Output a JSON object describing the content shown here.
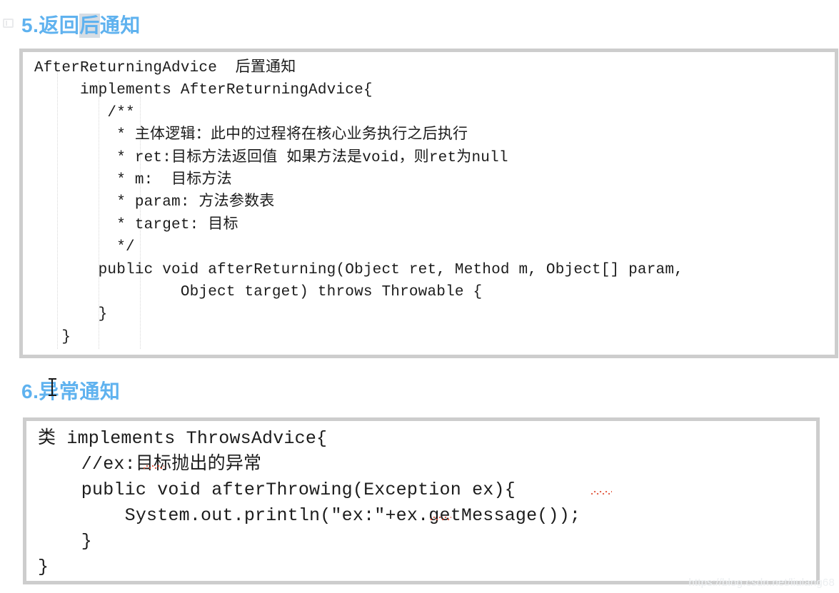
{
  "page": {
    "background_color": "#ffffff",
    "heading_color": "#5fb2ef",
    "selection_color": "#d6dde4",
    "code_border_color": "#cdcdcd",
    "code_text_color": "#1c1c1c",
    "squiggle_color": "#e04a2f"
  },
  "corner_icon": {
    "name": "document-outline-icon"
  },
  "sections": [
    {
      "heading": {
        "prefix": "5.返回",
        "selected": "后",
        "suffix": "通知",
        "full": "5.返回后通知"
      },
      "code": "AfterReturningAdvice  后置通知\n     implements AfterReturningAdvice{\n        /**\n         * 主体逻辑：此中的过程将在核心业务执行之后执行\n         * ret:目标方法返回值 如果方法是void，则ret为null\n         * m:  目标方法\n         * param: 方法参数表\n         * target: 目标\n         */\n       public void afterReturning(Object ret, Method m, Object[] param,\n                Object target) throws Throwable {\n       }\n   }"
    },
    {
      "heading": {
        "prefix": "6.",
        "selected": "",
        "suffix": "异常通知",
        "full": "6.异常通知"
      },
      "code": "类 implements ThrowsAdvice{\n    //ex:目标抛出的异常\n    public void afterThrowing(Exception ex){\n        System.out.println(\"ex:\"+ex.getMessage());\n    }\n}"
    }
  ],
  "cursor": {
    "name": "text-ibeam-cursor",
    "over": "异"
  },
  "watermark": {
    "text": "https://blog.csdn.net/liulang68"
  }
}
